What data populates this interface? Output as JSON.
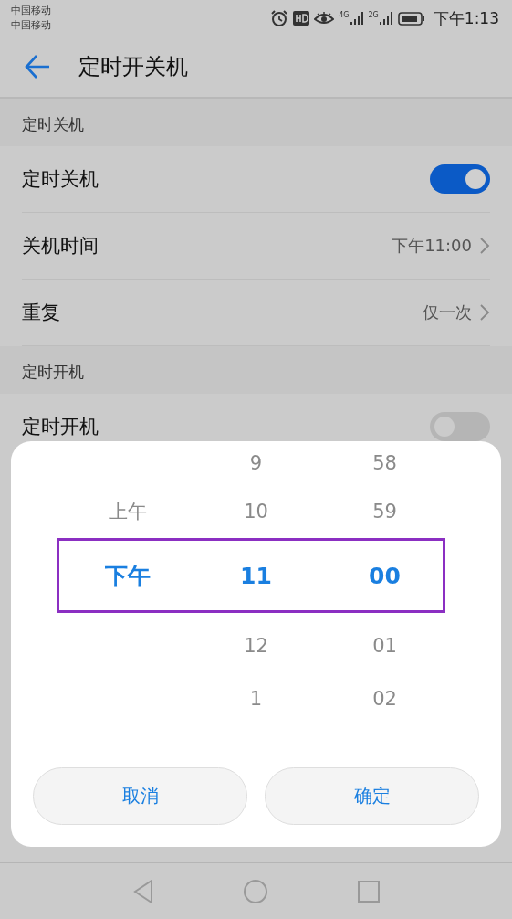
{
  "status_bar": {
    "carriers": [
      "中国移动",
      "中国移动"
    ],
    "network_labels": [
      "4G",
      "2G"
    ],
    "time": "下午1:13"
  },
  "header": {
    "title": "定时开关机"
  },
  "sections": [
    {
      "title": "定时关机",
      "rows": [
        {
          "kind": "toggle",
          "label": "定时关机",
          "on": true
        },
        {
          "kind": "value",
          "label": "关机时间",
          "value": "下午11:00"
        },
        {
          "kind": "value",
          "label": "重复",
          "value": "仅一次"
        }
      ]
    },
    {
      "title": "定时开机",
      "rows": [
        {
          "kind": "toggle",
          "label": "定时开机",
          "on": false
        }
      ]
    }
  ],
  "dialog": {
    "columns": [
      {
        "items": [
          {
            "text": "上午",
            "selected": false
          },
          {
            "text": "下午",
            "selected": true
          }
        ]
      },
      {
        "items": [
          {
            "text": "9",
            "selected": false
          },
          {
            "text": "10",
            "selected": false
          },
          {
            "text": "11",
            "selected": true
          },
          {
            "text": "12",
            "selected": false
          },
          {
            "text": "1",
            "selected": false
          }
        ]
      },
      {
        "items": [
          {
            "text": "58",
            "selected": false
          },
          {
            "text": "59",
            "selected": false
          },
          {
            "text": "00",
            "selected": true
          },
          {
            "text": "01",
            "selected": false
          },
          {
            "text": "02",
            "selected": false
          }
        ]
      }
    ],
    "buttons": [
      "取消",
      "确定"
    ]
  }
}
